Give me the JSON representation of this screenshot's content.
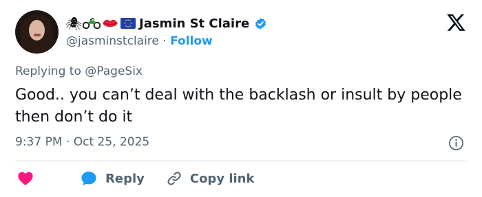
{
  "author": {
    "name": "Jasmin St Claire",
    "handle": "@jasminstclaire",
    "separator": "·",
    "follow_label": "Follow",
    "emoji_icons": [
      "spider-icon",
      "motorcycle-icon",
      "lips-icon",
      "eu-flag-icon"
    ],
    "verified_color": "#1d9bf0"
  },
  "reply_context": {
    "prefix": "Replying to",
    "mention": "@PageSix"
  },
  "tweet": {
    "text": "Good.. you can’t deal with the backlash or insult by people then don’t do it",
    "time": "9:37 PM",
    "dot": "·",
    "date": "Oct 25, 2025"
  },
  "actions": {
    "reply_label": "Reply",
    "copy_link_label": "Copy link"
  },
  "colors": {
    "accent": "#1d9bf0",
    "muted": "#536471",
    "heart": "#f91880",
    "text": "#0f1419"
  }
}
